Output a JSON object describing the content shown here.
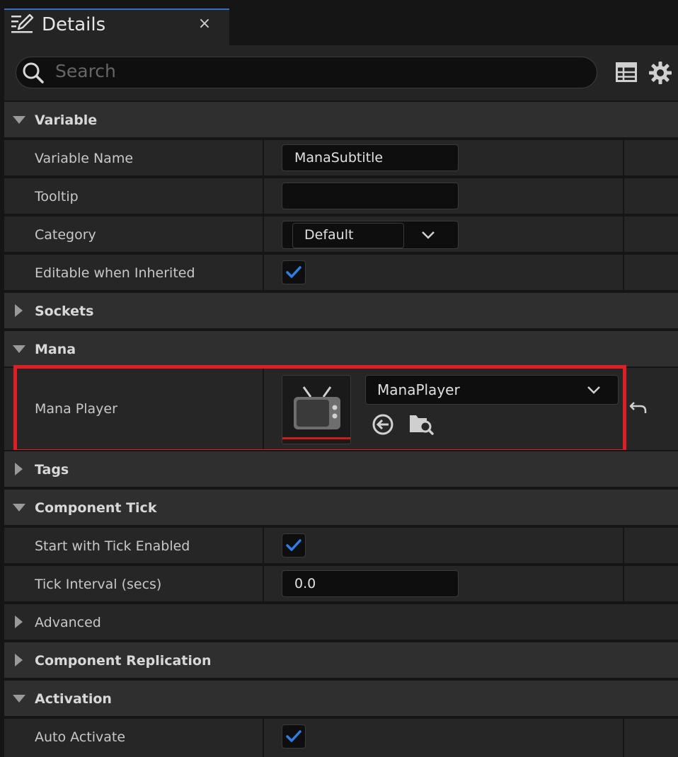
{
  "tab": {
    "title": "Details",
    "close": "×"
  },
  "search": {
    "placeholder": "Search"
  },
  "variable": {
    "section": "Variable",
    "name_label": "Variable Name",
    "name_value": "ManaSubtitle",
    "tooltip_label": "Tooltip",
    "tooltip_value": "",
    "category_label": "Category",
    "category_value": "Default",
    "editable_label": "Editable when Inherited",
    "editable_checked": true
  },
  "sockets": {
    "section": "Sockets"
  },
  "mana": {
    "section": "Mana",
    "player_label": "Mana Player",
    "player_asset": "ManaPlayer"
  },
  "tags": {
    "section": "Tags"
  },
  "component_tick": {
    "section": "Component Tick",
    "start_label": "Start with Tick Enabled",
    "start_checked": true,
    "interval_label": "Tick Interval (secs)",
    "interval_value": "0.0"
  },
  "advanced": {
    "section": "Advanced"
  },
  "replication": {
    "section": "Component Replication"
  },
  "activation": {
    "section": "Activation",
    "auto_label": "Auto Activate",
    "auto_checked": true
  },
  "colors": {
    "accent": "#2e7ee6",
    "highlight": "#e01e25",
    "panel": "#262626",
    "category": "#2f2f2f"
  }
}
